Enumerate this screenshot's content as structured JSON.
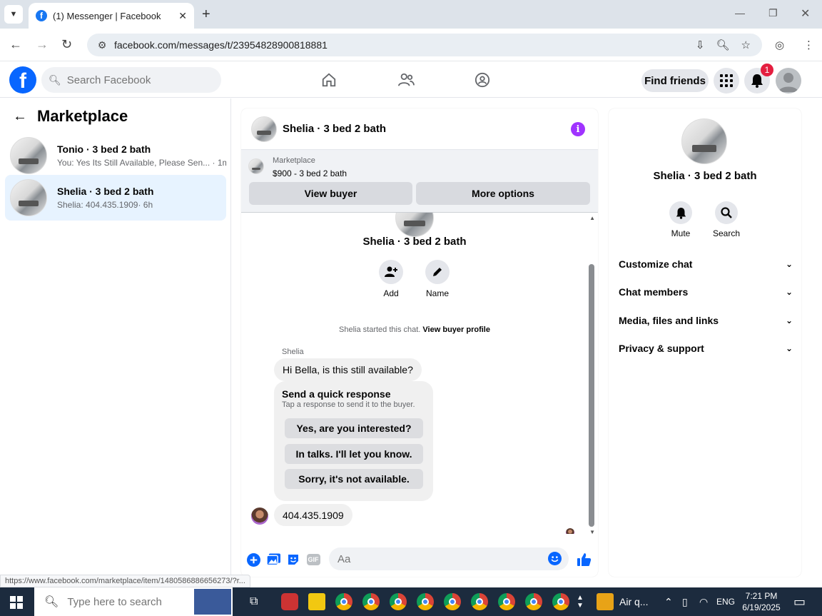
{
  "browser": {
    "tab_title": "(1) Messenger | Facebook",
    "url": "facebook.com/messages/t/23954828900818881",
    "status_url": "https://www.facebook.com/marketplace/item/1480586886656273/?r..."
  },
  "fb": {
    "search_placeholder": "Search Facebook",
    "find_friends": "Find friends",
    "notification_count": "1"
  },
  "sidebar": {
    "title": "Marketplace",
    "conversations": [
      {
        "name": "Tonio · 3 bed 2 bath",
        "preview": "You: Yes Its Still Available, Please Sen...",
        "time": "· 1m"
      },
      {
        "name": "Shelia · 3 bed 2 bath",
        "preview": "Shelia: 404.435.1909",
        "time": "· 6h"
      }
    ]
  },
  "chat": {
    "title": "Shelia · 3 bed 2 bath",
    "marketplace_label": "Marketplace",
    "listing": "$900 - 3 bed 2 bath",
    "view_buyer": "View buyer",
    "more_options": "More options",
    "profile_name": "Shelia · 3 bed 2 bath",
    "add_label": "Add",
    "name_label": "Name",
    "started_text": "Shelia started this chat.",
    "view_buyer_profile": "View buyer profile",
    "sender": "Shelia",
    "message1": "Hi Bella, is this still available?",
    "quick_title": "Send a quick response",
    "quick_sub": "Tap a response to send it to the buyer.",
    "quick_responses": [
      "Yes, are you interested?",
      "In talks. I'll let you know.",
      "Sorry, it's not available."
    ],
    "message2": "404.435.1909",
    "composer_placeholder": "Aa",
    "gif_label": "GIF"
  },
  "right_panel": {
    "name": "Shelia · 3 bed 2 bath",
    "mute": "Mute",
    "search": "Search",
    "sections": [
      "Customize chat",
      "Chat members",
      "Media, files and links",
      "Privacy & support"
    ]
  },
  "taskbar": {
    "search_placeholder": "Type here to search",
    "weather": "Air q...",
    "lang": "ENG",
    "time": "7:21 PM",
    "date": "6/19/2025"
  }
}
